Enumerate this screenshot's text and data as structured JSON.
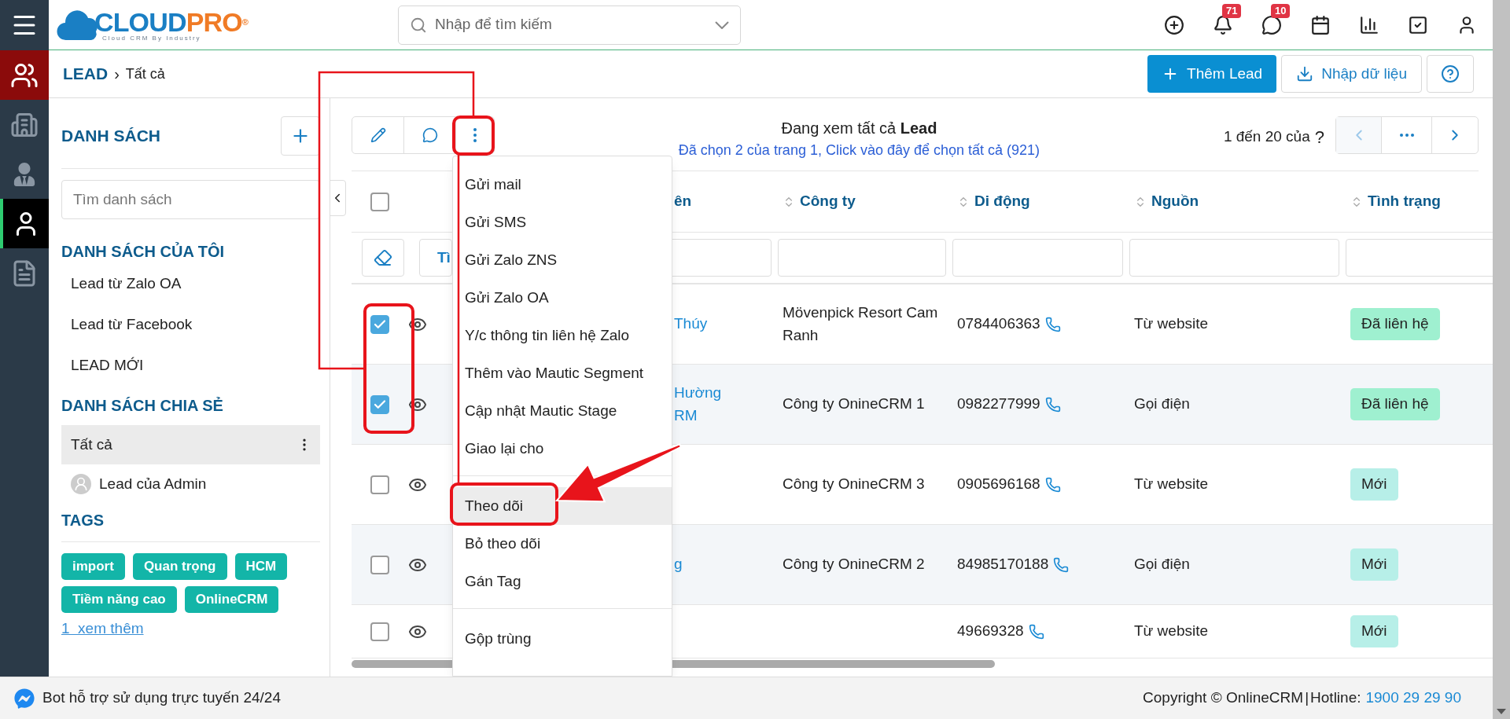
{
  "logo": {
    "primary": "CLOUD",
    "accent": "PRO",
    "mark": "®",
    "tagline": "Cloud CRM By Industry"
  },
  "rail": [
    {
      "kind": "group"
    },
    {
      "kind": "plain"
    },
    {
      "kind": "plain"
    },
    {
      "kind": "current"
    },
    {
      "kind": "plain"
    }
  ],
  "search": {
    "placeholder": "Nhập để tìm kiếm"
  },
  "top_icons": [
    {
      "kind": "add"
    },
    {
      "kind": "bell",
      "badge": "71"
    },
    {
      "kind": "chat",
      "badge": "10"
    },
    {
      "kind": "calendar"
    },
    {
      "kind": "chart"
    },
    {
      "kind": "tasks"
    },
    {
      "kind": "account"
    }
  ],
  "breadcrumb": {
    "module": "LEAD",
    "separator": "›",
    "view": "Tất cả"
  },
  "header_buttons": {
    "add": "Thêm Lead",
    "import": "Nhập dữ liệu"
  },
  "sidebar": {
    "title": "DANH SÁCH",
    "search_placeholder": "Tìm danh sách",
    "my_lists_title": "DANH SÁCH CỦA TÔI",
    "my_lists": [
      {
        "label": "Lead từ Zalo OA"
      },
      {
        "label": "Lead từ Facebook"
      },
      {
        "label": "LEAD MỚI"
      }
    ],
    "shared_title": "DANH SÁCH CHIA SẺ",
    "shared": [
      {
        "label": "Tất cả",
        "selected": true,
        "kind": "list"
      },
      {
        "label": "Lead của Admin",
        "selected": false,
        "kind": "user"
      }
    ],
    "tags_title": "TAGS",
    "tags": [
      "import",
      "Quan trọng",
      "HCM",
      "Tiềm năng cao",
      "OnlineCRM"
    ],
    "more_link": "1  xem thêm"
  },
  "view_info": {
    "text": "Đang xem tất cả **Lead**",
    "selection_link": "Đã chọn 2 của trang 1, Click vào đây để chọn tất cả (921)"
  },
  "pager": {
    "range": "1 đến 20 của",
    "total": "?"
  },
  "table": {
    "select_all": {
      "checked": false
    },
    "columns": [
      {
        "label": "ên",
        "sortable": false
      },
      {
        "label": "Công ty",
        "sortable": true
      },
      {
        "label": "Di động",
        "sortable": true
      },
      {
        "label": "Nguồn",
        "sortable": true
      },
      {
        "label": "Tình trạng",
        "sortable": true
      }
    ],
    "filter_button": "Tì",
    "rows": [
      {
        "selected": true,
        "name": "Thúy",
        "company": "Mövenpick Resort Cam Ranh",
        "mobile": "0784406363",
        "source": "Từ website",
        "status": {
          "label": "Đã liên hệ",
          "kind": "contacted"
        }
      },
      {
        "selected": true,
        "name": "Hường RM",
        "company": "Công ty OnineCRM 1",
        "mobile": "0982277999",
        "source": "Gọi điện",
        "status": {
          "label": "Đã liên hệ",
          "kind": "contacted"
        }
      },
      {
        "selected": false,
        "company": "Công ty OnineCRM 3",
        "mobile": "0905696168",
        "source": "Từ website",
        "status": {
          "label": "Mới",
          "kind": "new"
        }
      },
      {
        "selected": false,
        "name": "g",
        "company": "Công ty OnineCRM 2",
        "mobile": "84985170188",
        "source": "Gọi điện",
        "status": {
          "label": "Mới",
          "kind": "new"
        }
      },
      {
        "selected": false,
        "mobile": "49669328",
        "source": "Từ website",
        "status": {
          "label": "Mới",
          "kind": "new"
        }
      }
    ]
  },
  "action_menu": {
    "groups": [
      [
        {
          "label": "Gửi mail",
          "selected": false
        },
        {
          "label": "Gửi SMS",
          "selected": false
        },
        {
          "label": "Gửi Zalo ZNS",
          "selected": false
        },
        {
          "label": "Gửi Zalo OA",
          "selected": false
        },
        {
          "label": "Y/c thông tin liên hệ Zalo",
          "selected": false
        },
        {
          "label": "Thêm vào Mautic Segment",
          "selected": false
        },
        {
          "label": "Cập nhật Mautic Stage",
          "selected": false
        },
        {
          "label": "Giao lại cho",
          "selected": false
        }
      ],
      [
        {
          "label": "Theo dõi",
          "selected": true
        },
        {
          "label": "Bỏ theo dõi",
          "selected": false
        },
        {
          "label": "Gán Tag",
          "selected": false
        }
      ],
      [
        {
          "label": "Gộp trùng",
          "selected": false
        }
      ]
    ]
  },
  "footer": {
    "bot": "Bot hỗ trợ sử dụng trực tuyến 24/24",
    "copyright": "Copyright © OnlineCRM",
    "separator": "|",
    "hotline_label": "Hotline:",
    "hotline": "1900 29 29 90"
  }
}
